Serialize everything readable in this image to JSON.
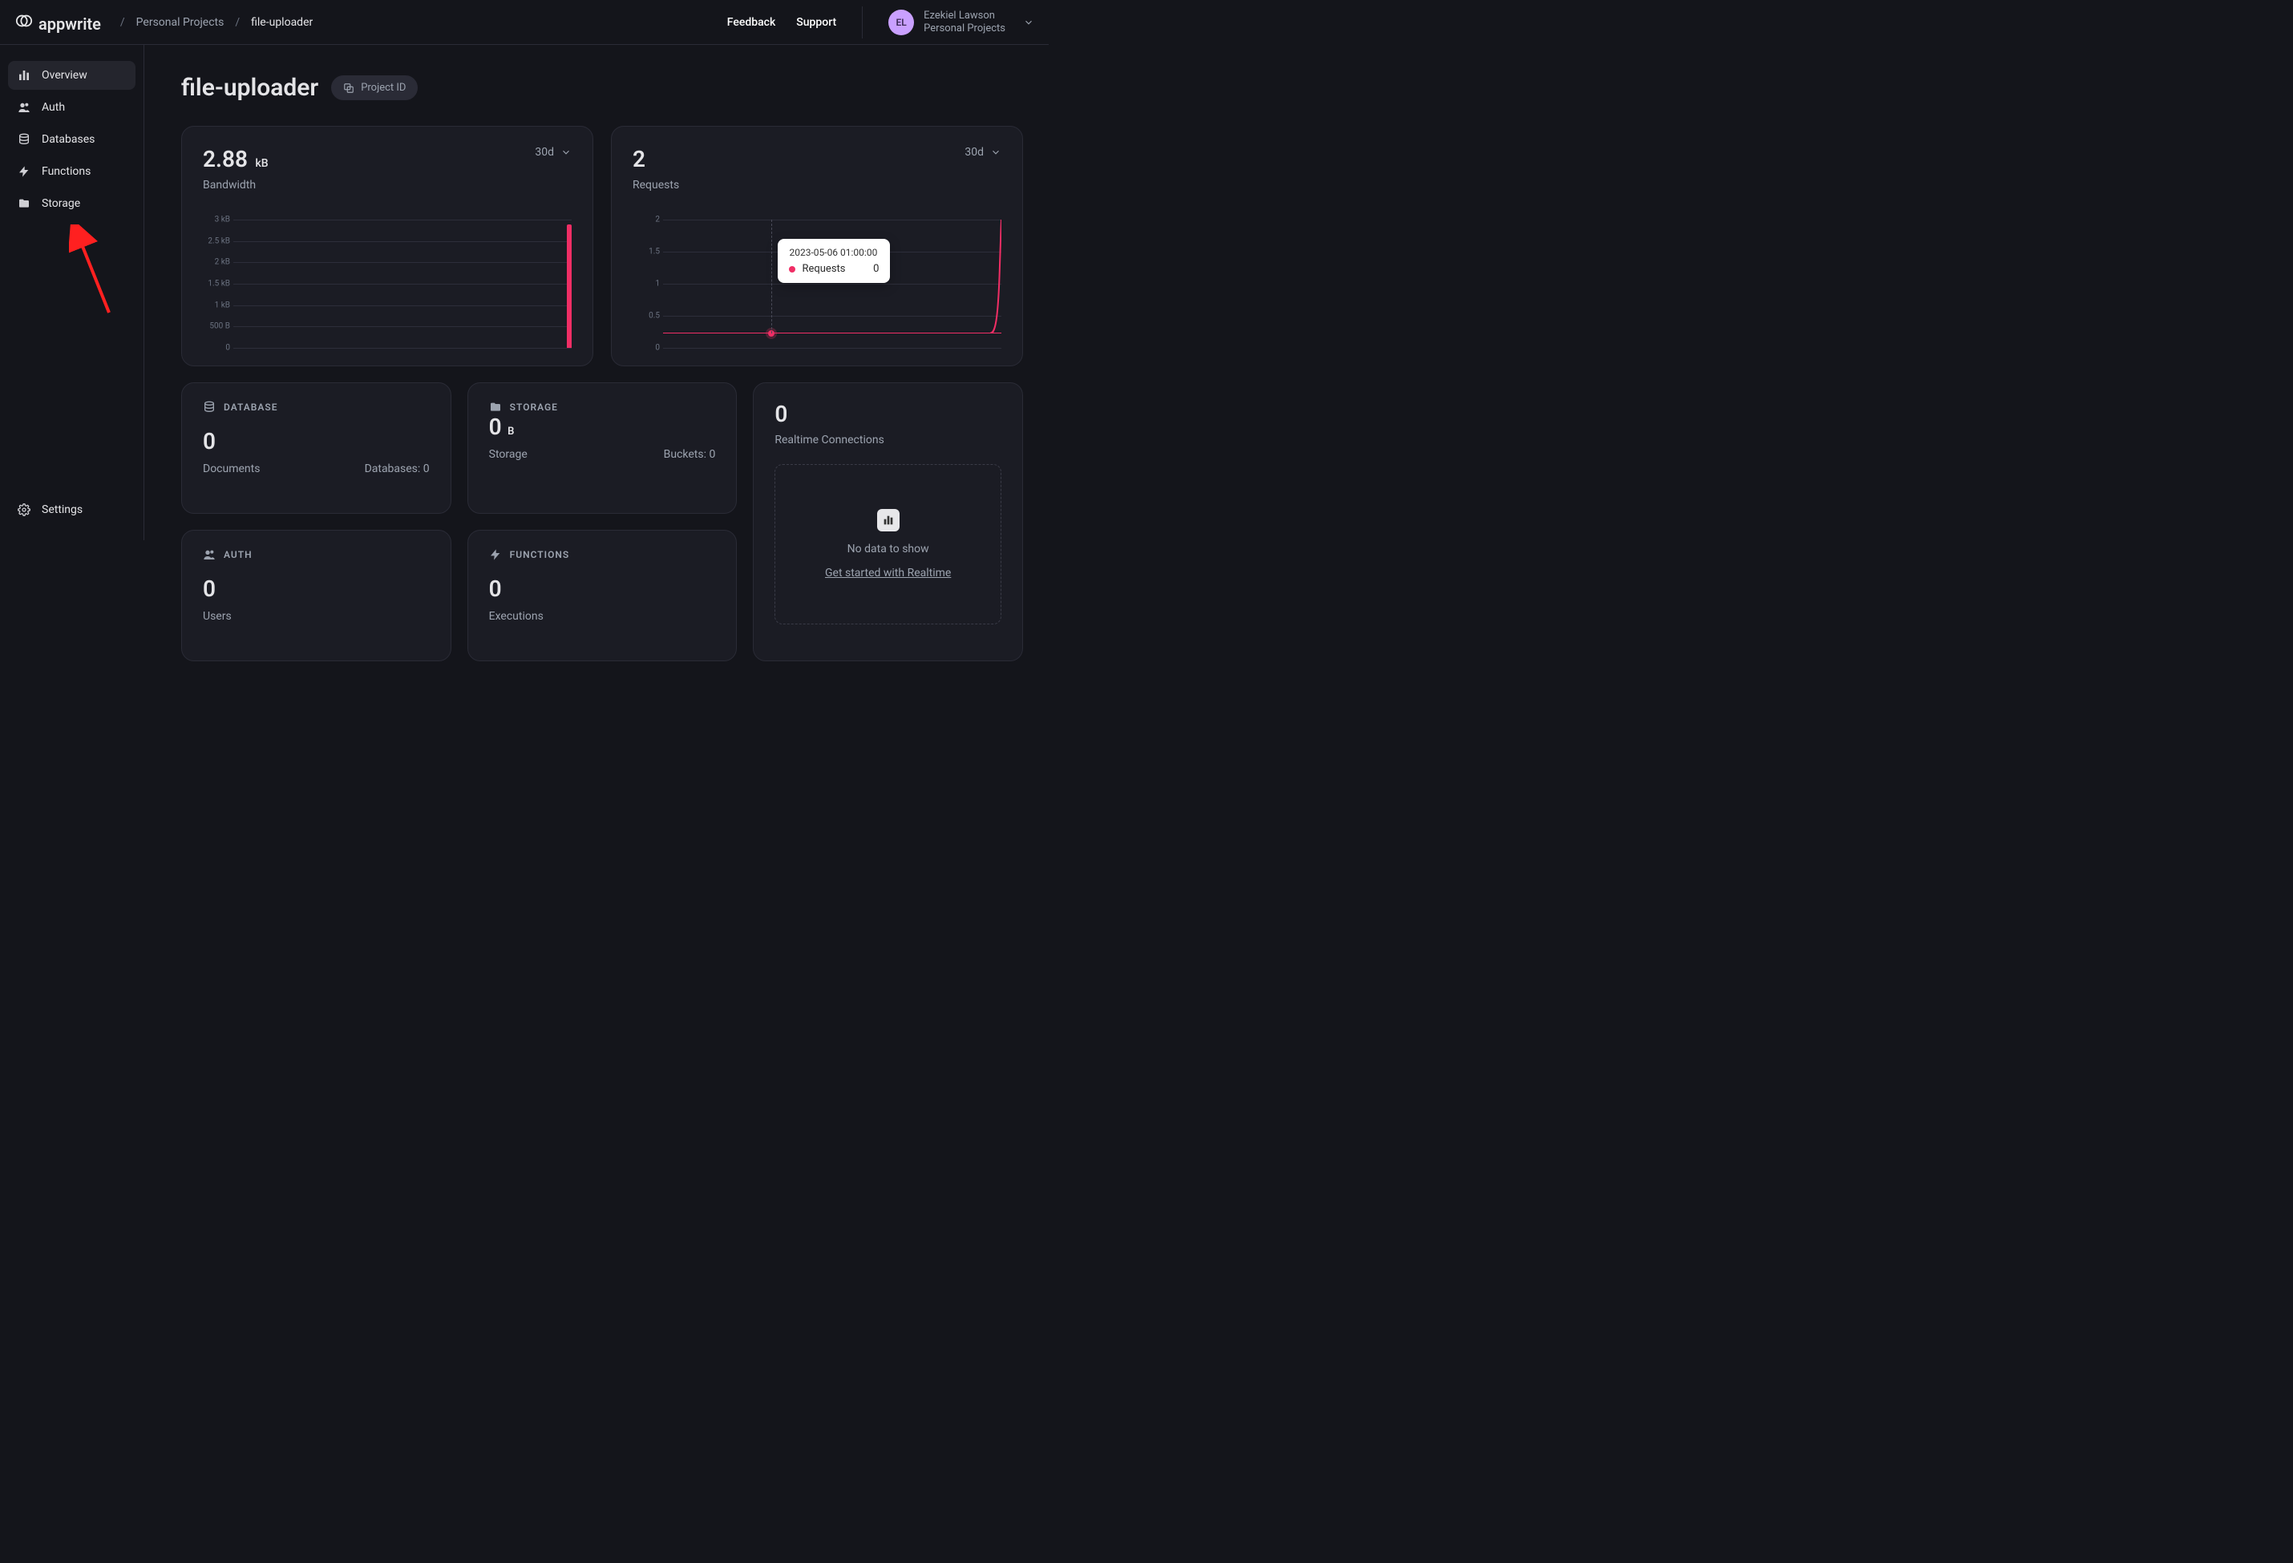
{
  "brand": "appwrite",
  "breadcrumbs": {
    "org": "Personal Projects",
    "project": "file-uploader"
  },
  "topbar": {
    "feedback": "Feedback",
    "support": "Support"
  },
  "user": {
    "initials": "EL",
    "name": "Ezekiel Lawson",
    "org": "Personal Projects"
  },
  "sidebar": {
    "items": [
      {
        "label": "Overview",
        "icon": "overview-icon",
        "active": true
      },
      {
        "label": "Auth",
        "icon": "auth-icon",
        "active": false
      },
      {
        "label": "Databases",
        "icon": "database-icon",
        "active": false
      },
      {
        "label": "Functions",
        "icon": "functions-icon",
        "active": false
      },
      {
        "label": "Storage",
        "icon": "storage-icon",
        "active": false
      }
    ],
    "settings_label": "Settings"
  },
  "page": {
    "title": "file-uploader",
    "project_id_pill": "Project ID"
  },
  "range_options": {
    "selected": "30d"
  },
  "bandwidth_card": {
    "value": "2.88",
    "unit": "kB",
    "label": "Bandwidth",
    "range": "30d",
    "y_ticks": [
      "3 kB",
      "2.5 kB",
      "2 kB",
      "1.5 kB",
      "1 kB",
      "500 B",
      "0"
    ]
  },
  "requests_card": {
    "value": "2",
    "label": "Requests",
    "range": "30d",
    "y_ticks": [
      "2",
      "1.5",
      "1",
      "0.5",
      "0"
    ],
    "tooltip": {
      "date": "2023-05-06 01:00:00",
      "series_label": "Requests",
      "series_value": "0"
    }
  },
  "chart_data": [
    {
      "type": "bar",
      "title": "Bandwidth",
      "ylabel": "",
      "xlabel": "",
      "categories_note": "30 daily buckets, only last day non-zero",
      "values_last_day_bytes": 2880,
      "y_ticks_bytes": [
        0,
        500,
        1000,
        1500,
        2000,
        2500,
        3000
      ],
      "ylim": [
        0,
        3000
      ]
    },
    {
      "type": "line",
      "title": "Requests",
      "ylabel": "",
      "xlabel": "",
      "y_ticks": [
        0,
        0.5,
        1,
        1.5,
        2
      ],
      "ylim": [
        0,
        2
      ],
      "series": [
        {
          "name": "Requests",
          "values_note": "flat 0 for ~29 days then spike to 2 on the last point"
        }
      ],
      "hover_point": {
        "date": "2023-05-06 01:00:00",
        "value": 0
      }
    }
  ],
  "small_cards": {
    "database": {
      "title": "DATABASE",
      "value": "0",
      "left": "Documents",
      "right": "Databases: 0"
    },
    "storage": {
      "title": "STORAGE",
      "value": "0",
      "unit": "B",
      "left": "Storage",
      "right": "Buckets: 0"
    },
    "realtime": {
      "value": "0",
      "label": "Realtime Connections",
      "empty_msg": "No data to show",
      "link": "Get started with Realtime"
    },
    "auth": {
      "title": "AUTH",
      "value": "0",
      "left": "Users"
    },
    "functions": {
      "title": "FUNCTIONS",
      "value": "0",
      "left": "Executions"
    }
  }
}
